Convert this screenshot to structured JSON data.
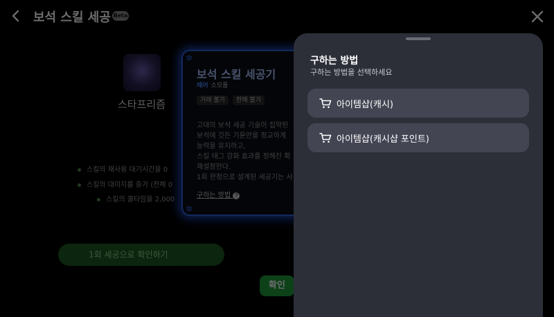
{
  "page": {
    "title": "보석 스킬 세공",
    "badge": "Beta"
  },
  "gem": {
    "name": "스타프리즘"
  },
  "stats": [
    "스킬의 재사용 대기시간을 0",
    "스킬의 대미지를 증가 (전체 0",
    "스킬의 쿨타임을 2,000"
  ],
  "green_bar": "1회 세공으로 확인하기",
  "confirm_label": "확인",
  "card": {
    "title": "보석 스킬 세공기",
    "rarity": "레어",
    "category": "소모품",
    "chips": [
      "거래 불가",
      "판매 불가"
    ],
    "description": "고대의 보석 세공 기술이 집약된\n보석에 깃든 기운만을 정교하게\n능력을 유지하고,\n스킬 태그 강화 효과를 정해진 확\n재설정한다.\n1회 한정으로 설계된 세공기는 사",
    "how_to_get": "구하는 방법"
  },
  "sheet": {
    "title": "구하는 방법",
    "subtitle": "구하는 방법을 선택하세요",
    "options": [
      {
        "label": "아이템샵(캐시)",
        "icon": "cart-icon"
      },
      {
        "label": "아이템샵(캐시샵 포인트)",
        "icon": "cart-icon"
      }
    ]
  },
  "colors": {
    "sheet_bg": "#2c2e38",
    "option_bg": "#434553",
    "card_glow": "#2f63e0",
    "confirm": "#1f9b3b"
  }
}
